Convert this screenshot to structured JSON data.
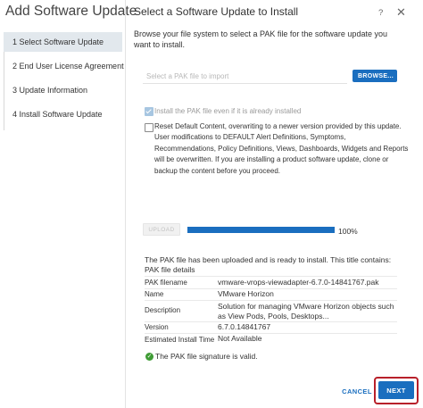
{
  "wizard": {
    "title": "Add Software Update",
    "steps": [
      {
        "label": "1 Select Software Update",
        "active": true
      },
      {
        "label": "2 End User License Agreement",
        "active": false
      },
      {
        "label": "3 Update Information",
        "active": false
      },
      {
        "label": "4 Install Software Update",
        "active": false
      }
    ]
  },
  "header": {
    "title": "Select a Software Update to Install",
    "help_icon": "question-mark",
    "close_icon": "x"
  },
  "browse": {
    "description": "Browse your file system to select a PAK file for the software update you want to install.",
    "placeholder": "Select a PAK file to import",
    "button_label": "BROWSE..."
  },
  "options": {
    "install_even_if_installed": {
      "label": "Install the PAK file even if it is already installed",
      "checked": true
    },
    "reset_default_content": {
      "label": "Reset Default Content, overwriting to a newer version provided by this update. User modifications to DEFAULT Alert Definitions, Symptoms, Recommendations, Policy Definitions, Views, Dashboards, Widgets and Reports will be overwritten. If you are installing a product software update, clone or backup the content before you proceed.",
      "checked": false
    }
  },
  "upload": {
    "button_label": "UPLOAD",
    "progress_percent": 100,
    "progress_label": "100%"
  },
  "result": {
    "status": "The PAK file has been uploaded and is ready to install. This title contains:",
    "details_title": "PAK file details",
    "rows": [
      {
        "label": "PAK filename",
        "value": "vmware-vrops-viewadapter-6.7.0-14841767.pak"
      },
      {
        "label": "Name",
        "value": "VMware Horizon"
      },
      {
        "label": "Description",
        "value": "Solution for managing VMware Horizon objects such as View Pods, Pools, Desktops..."
      },
      {
        "label": "Version",
        "value": "6.7.0.14841767"
      },
      {
        "label": "Estimated Install Time",
        "value": "Not Available"
      }
    ],
    "signature_text": "The PAK file signature is valid.",
    "signature_icon": "check-circle",
    "signature_color": "#3f9c35"
  },
  "footer": {
    "cancel_label": "CANCEL",
    "next_label": "NEXT"
  },
  "colors": {
    "primary": "#1a6ebf",
    "active_step_bg": "#e2e8ed",
    "highlight": "#b8202a"
  }
}
